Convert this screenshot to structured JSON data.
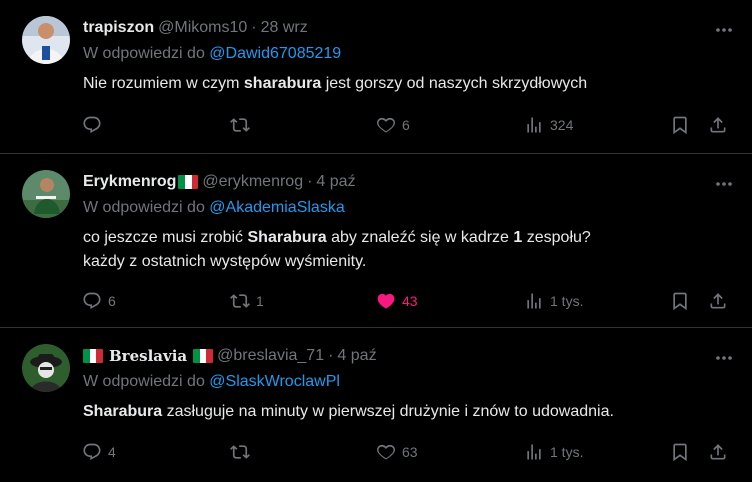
{
  "colors": {
    "background": "#000000",
    "text": "#e7e9ea",
    "muted": "#71767b",
    "link": "#1d9bf0",
    "like_active": "#f91880",
    "divider": "#2f3336"
  },
  "reply_prefix": "W odpowiedzi do",
  "tweets": [
    {
      "name": "trapiszon",
      "handle": "@Mikoms10",
      "separator": "·",
      "time": "28 wrz",
      "reply_to": "@Dawid67085219",
      "text_before": "Nie rozumiem w czym ",
      "text_bold": "sharabura",
      "text_after": " jest gorszy od naszych skrzydłowych",
      "replies": "",
      "reposts": "",
      "likes": "6",
      "views": "324",
      "liked": false
    },
    {
      "name": "Erykmenrog",
      "flag": "italy-flag",
      "handle": "@erykmenrog",
      "separator": "·",
      "time": "4 paź",
      "reply_to": "@AkademiaSlaska",
      "line1_a": "co jeszcze musi zrobić ",
      "line1_b": "Sharabura",
      "line1_c": " aby znaleźć się w kadrze ",
      "line1_d": "1",
      "line1_e": " zespołu?",
      "line2": "każdy z ostatnich występów wyśmienity.",
      "replies": "6",
      "reposts": "1",
      "likes": "43",
      "views": "1 tys.",
      "liked": true
    },
    {
      "name": "Breslavia",
      "flag_left": "italy-flag",
      "flag_right": "italy-flag",
      "handle": "@breslavia_71",
      "separator": "·",
      "time": "4 paź",
      "reply_to": "@SlaskWroclawPl",
      "text_bold": "Sharabura",
      "text_after": " zasługuje na minuty w pierwszej drużynie i znów to udowadnia.",
      "replies": "4",
      "reposts": "",
      "likes": "63",
      "views": "1 tys.",
      "liked": false
    }
  ],
  "icons": [
    "more-icon",
    "reply-icon",
    "repost-icon",
    "like-icon",
    "views-icon",
    "bookmark-icon",
    "share-icon"
  ]
}
